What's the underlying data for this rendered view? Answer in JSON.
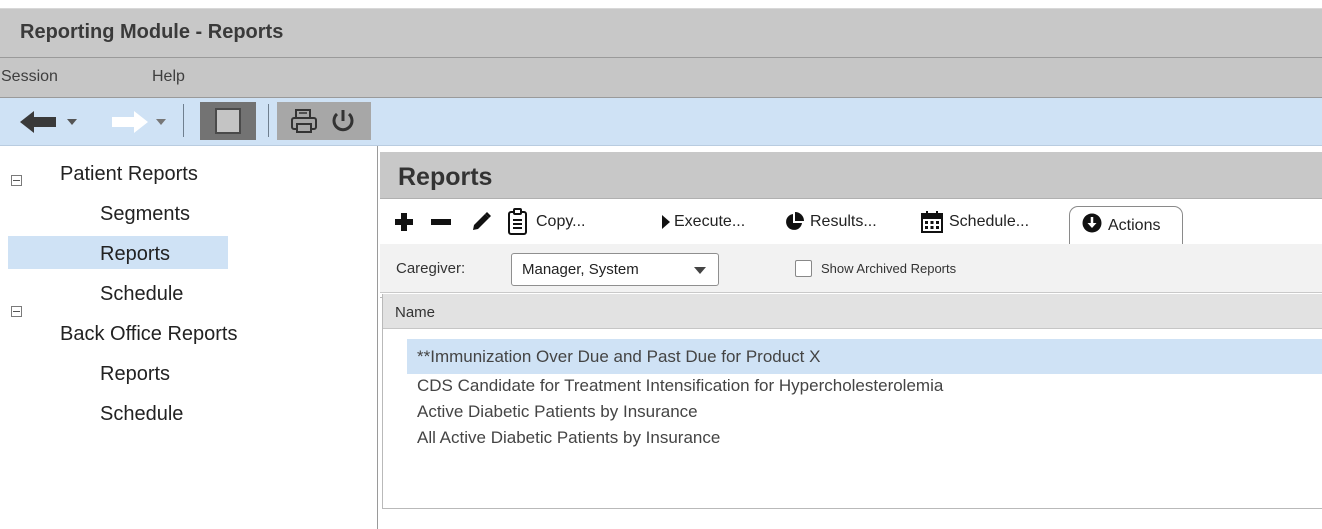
{
  "window": {
    "title": "Reporting Module - Reports"
  },
  "menu": {
    "items": [
      "Session",
      "Help"
    ]
  },
  "toolbar": {
    "icons": [
      "back-arrow-icon",
      "forward-arrow-icon",
      "stop-square-icon",
      "printer-icon",
      "power-icon"
    ]
  },
  "tree": {
    "groups": [
      {
        "label": "Patient Reports",
        "children": [
          "Segments",
          "Reports",
          "Schedule"
        ]
      },
      {
        "label": "Back Office Reports",
        "children": [
          "Reports",
          "Schedule"
        ]
      }
    ],
    "selected": "Patient Reports/Reports"
  },
  "reports": {
    "title": "Reports",
    "actions": {
      "copy": "Copy...",
      "execute": "Execute...",
      "results": "Results...",
      "schedule": "Schedule...",
      "actions": "Actions"
    },
    "filter": {
      "caregiver_label": "Caregiver:",
      "caregiver_value": "Manager, System",
      "archived_label": "Show Archived Reports",
      "archived_checked": false
    },
    "columns": [
      "Name"
    ],
    "rows": [
      "**Immunization Over Due and Past Due for Product X",
      "CDS Candidate for Treatment Intensification for Hypercholesterolemia",
      "Active Diabetic Patients by Insurance",
      "All Active Diabetic Patients by Insurance"
    ],
    "selected_row": 0
  },
  "colors": {
    "title_bar": "#c8c8c8",
    "toolbar_bg": "#cfe2f5",
    "selection": "#cfe2f5"
  }
}
